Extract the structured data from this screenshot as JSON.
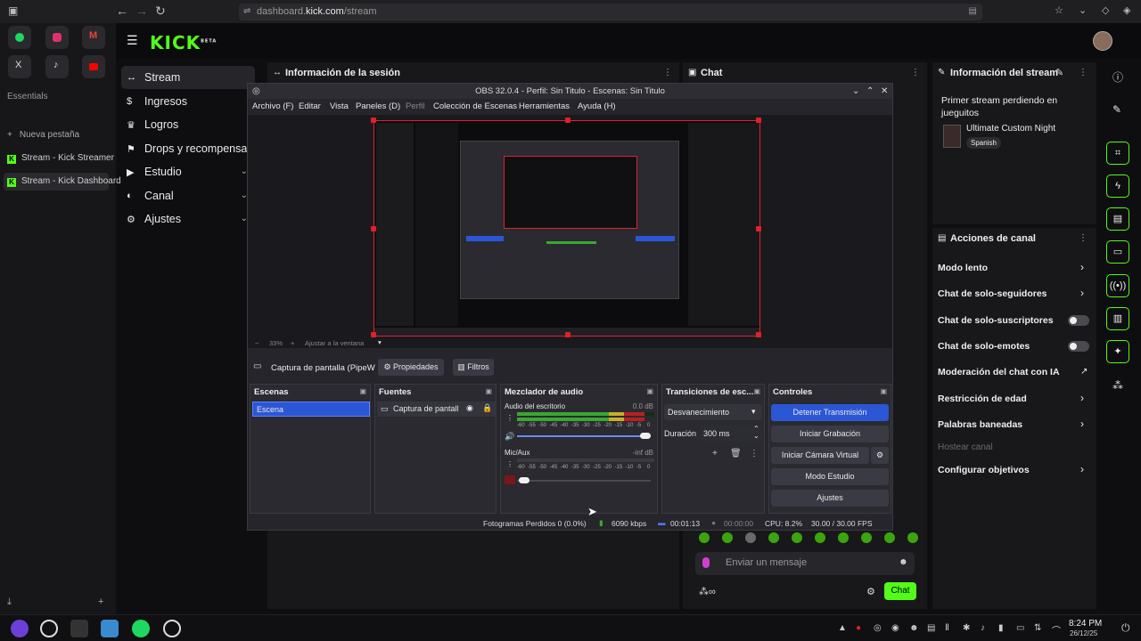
{
  "browser": {
    "url_prefix": "dashboard.",
    "url_domain": "kick.com",
    "url_path": "/stream",
    "essentials_label": "Essentials",
    "new_tab_label": "Nueva pestaña",
    "tabs": [
      {
        "label": "Stream - Kick Streamer"
      },
      {
        "label": "Stream - Kick Dashboard"
      }
    ]
  },
  "kick": {
    "logo": "KICK",
    "logo_sup": "BETA",
    "nav": [
      {
        "label": "Stream",
        "icon": "↔"
      },
      {
        "label": "Ingresos",
        "icon": "$"
      },
      {
        "label": "Logros",
        "icon": "♛"
      },
      {
        "label": "Drops y recompensas",
        "icon": "⚑"
      },
      {
        "label": "Estudio",
        "icon": "▶"
      },
      {
        "label": "Canal",
        "icon": "◐"
      },
      {
        "label": "Ajustes",
        "icon": "⚙"
      }
    ],
    "session_title": "Información de la sesión",
    "chat_title": "Chat",
    "chat_placeholder": "Enviar un mensaje",
    "chat_button": "Chat",
    "stream_info_title": "Información del stream",
    "stream_title": "Primer stream perdiendo en jueguitos",
    "game": "Ultimate Custom Night",
    "language": "Spanish",
    "channel_actions_title": "Acciones de canal",
    "channel_actions": [
      {
        "label": "Modo lento",
        "control": "chevron"
      },
      {
        "label": "Chat de solo-seguidores",
        "control": "chevron"
      },
      {
        "label": "Chat de solo-suscriptores",
        "control": "toggle"
      },
      {
        "label": "Chat de solo-emotes",
        "control": "toggle"
      },
      {
        "label": "Moderación del chat con IA",
        "control": "external"
      },
      {
        "label": "Restricción de edad",
        "control": "chevron"
      },
      {
        "label": "Palabras baneadas",
        "control": "chevron"
      },
      {
        "label": "Hostear canal",
        "control": "none"
      },
      {
        "label": "Configurar objetivos",
        "control": "chevron"
      }
    ]
  },
  "obs": {
    "title": "OBS 32.0.4 - Perfil: Sin Titulo - Escenas: Sin Titulo",
    "menu": [
      "Archivo (F)",
      "Editar",
      "Vista",
      "Paneles (D)",
      "Perfil",
      "Colección de Escenas",
      "Herramientas",
      "Ayuda (H)"
    ],
    "zoom": "33%",
    "fit": "Ajustar a la ventana",
    "source_name": "Captura de pantalla (PipeW",
    "properties": "Propiedades",
    "filters": "Filtros",
    "scenes_title": "Escenas",
    "scene_item": "Escena",
    "sources_title": "Fuentes",
    "source_item": "Captura de pantall",
    "mixer_title": "Mezclador de audio",
    "mixer": [
      {
        "name": "Audio del escritorio",
        "db": "0.0 dB",
        "level": 0.93,
        "volume": 1.0
      },
      {
        "name": "Mic/Aux",
        "db": "-inf dB",
        "level": 0,
        "volume": 0.05
      }
    ],
    "meter_ticks": [
      "-60",
      "-55",
      "-50",
      "-45",
      "-40",
      "-35",
      "-30",
      "-25",
      "-20",
      "-15",
      "-10",
      "-5",
      "0"
    ],
    "transitions_title": "Transiciones de esc...",
    "transition": "Desvanecimiento",
    "duration_label": "Duración",
    "duration": "300 ms",
    "controls_title": "Controles",
    "controls": [
      "Detener Transmisión",
      "Iniciar Grabación",
      "Iniciar Cámara Virtual",
      "Modo Estudio",
      "Ajustes"
    ],
    "status": {
      "dropped": "Fotogramas Perdidos 0 (0.0%)",
      "kbps": "6090 kbps",
      "stream_time": "00:01:13",
      "rec_time": "00:00:00",
      "cpu": "CPU: 8.2%",
      "fps": "30.00 / 30.00 FPS"
    }
  },
  "taskbar": {
    "time": "8:24 PM",
    "date": "26/12/25"
  },
  "colors": {
    "kick_green": "#53fc18",
    "obs_blue": "#2b56d6",
    "selection_red": "#e0202a"
  }
}
